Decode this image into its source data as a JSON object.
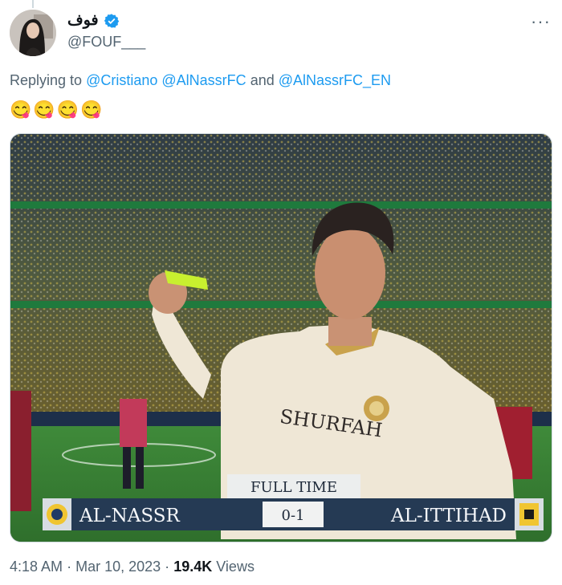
{
  "tweet": {
    "display_name": "فوف",
    "handle": "@FOUF___",
    "verified_icon": "verified-badge-icon",
    "more_label": "···",
    "reply_prefix": "Replying to",
    "mentions": [
      "@Cristiano",
      "@AlNassrFC",
      "@AlNassrFC_EN"
    ],
    "reply_and": "and",
    "emojis": "😋😋😋😋",
    "time": "4:18 AM",
    "sep": "·",
    "date": "Mar 10, 2023",
    "views_count": "19.4K",
    "views_label": "Views"
  },
  "image": {
    "scoreboard": {
      "status": "FULL TIME",
      "home": "AL-NASSR",
      "score": "0-1",
      "away": "AL-ITTIHAD"
    },
    "jersey_sponsor": "SHURFAH"
  },
  "colors": {
    "link": "#1d9bf0",
    "secondary_text": "#536471",
    "verified": "#1d9bf0"
  }
}
